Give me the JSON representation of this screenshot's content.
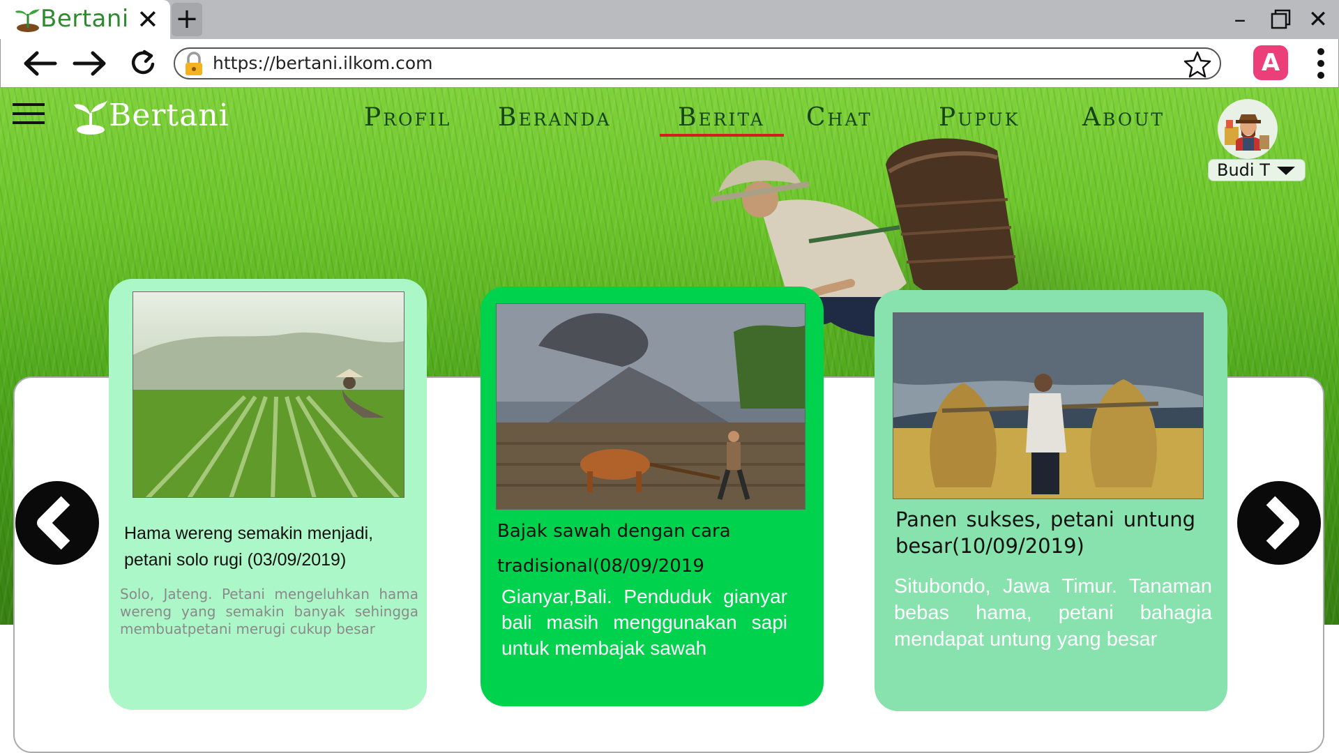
{
  "browser": {
    "tab_title": "Bertani",
    "url": "https://bertani.ilkom.com",
    "profile_letter": "A"
  },
  "site": {
    "brand": "Bertani",
    "menu": [
      "Profil",
      "Beranda",
      "Berita",
      "Chat",
      "Pupuk",
      "About"
    ],
    "active_menu": "Berita",
    "user_name": "Budi T"
  },
  "news": [
    {
      "title": "Hama wereng semakin menjadi, petani solo rugi (03/09/2019)",
      "description": "Solo, Jateng. Petani mengeluhkan hama wereng yang semakin banyak sehingga membuatpetani merugi cukup besar"
    },
    {
      "title": "Bajak sawah dengan cara tradisional(08/09/2019",
      "description": "Gianyar,Bali. Penduduk gianyar bali masih menggunakan sapi untuk membajak sawah"
    },
    {
      "title": "Panen sukses, petani untung besar(10/09/2019)",
      "description": "Situbondo, Jawa Timur. Tanaman bebas hama, petani bahagia mendapat untung yang besar"
    }
  ],
  "colors": {
    "card_1": "#abf7c8",
    "card_2": "#00d24e",
    "card_3": "#87e2ad",
    "active_underline": "#d21e1e",
    "menu_text": "#16431a"
  }
}
